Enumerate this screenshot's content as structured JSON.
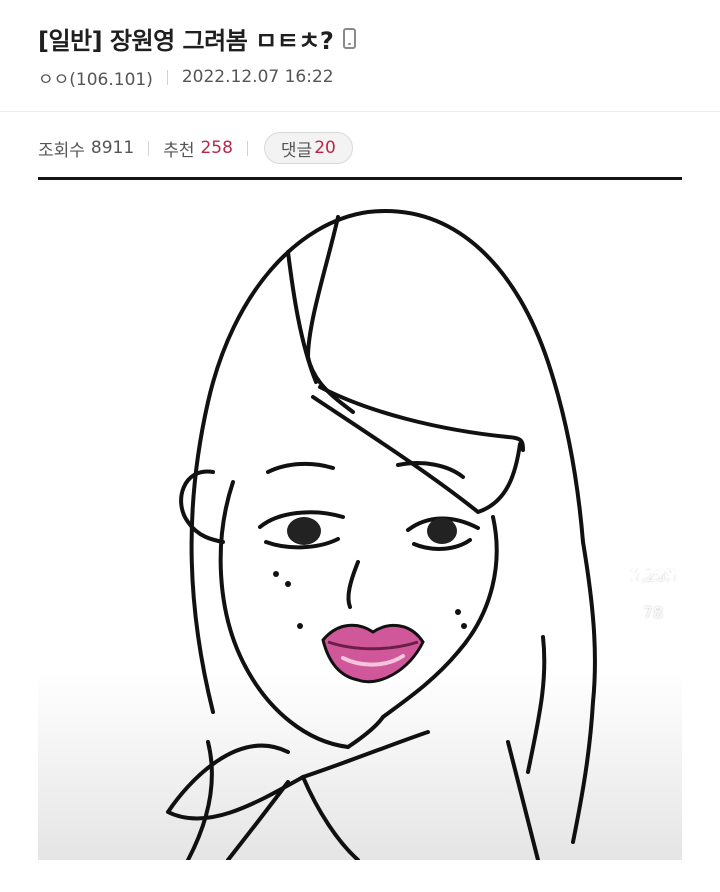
{
  "post": {
    "title": "[일반] 장원영 그려봄 ㅁㅌㅊ?",
    "author": "ㅇㅇ(106.101)",
    "datetime": "2022.12.07 16:22"
  },
  "stats": {
    "views_label": "조회수",
    "views": "8911",
    "recommend_label": "추천",
    "recommend": "258",
    "comments_label": "댓글",
    "comments": "20"
  },
  "video_overlay": {
    "like_count": "3,285",
    "comment_count": "78"
  },
  "colors": {
    "accent_red": "#b8274b",
    "lip_pink": "#d0579a"
  },
  "icons": [
    "mobile-icon",
    "heart-icon",
    "comment-bubble-icon",
    "repost-icon"
  ]
}
